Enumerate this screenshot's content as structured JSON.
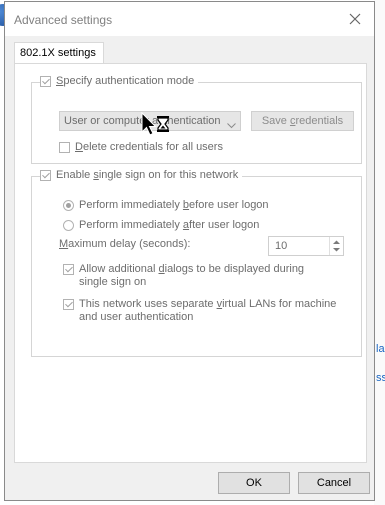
{
  "window": {
    "title": "Advanced settings",
    "close_icon": "close-icon"
  },
  "tabs": [
    {
      "label": "802.1X settings",
      "selected": true
    }
  ],
  "auth_group": {
    "specify_auth_mode": {
      "label_pre": "",
      "label_u": "S",
      "label_post": "pecify authentication mode",
      "checked": true
    },
    "auth_mode_dropdown": {
      "value_pre": "User or compute",
      "value_tail": "r authentication",
      "icon": "chevron-down-icon"
    },
    "save_credentials": {
      "label_pre": "Save ",
      "label_u": "c",
      "label_post": "redentials"
    },
    "delete_credentials": {
      "label_pre": "",
      "label_u": "D",
      "label_post": "elete credentials for all users",
      "checked": false
    }
  },
  "sso_group": {
    "enable_sso": {
      "label_pre": "Enable ",
      "label_u": "s",
      "label_post": "ingle sign on for this network",
      "checked": true
    },
    "before_logon": {
      "label_pre": "Perform immediately ",
      "label_u": "b",
      "label_post": "efore user logon",
      "selected": true
    },
    "after_logon": {
      "label_pre": "Perform immediately ",
      "label_u": "a",
      "label_post": "fter user logon",
      "selected": false
    },
    "max_delay": {
      "label_pre": "",
      "label_u": "M",
      "label_post": "aximum delay (seconds):",
      "value": "10"
    },
    "allow_dialogs": {
      "label_pre": "Allow additional ",
      "label_u": "d",
      "label_post": "ialogs to be displayed during single sign on",
      "checked": true
    },
    "separate_vlans": {
      "label_pre": "This network uses separate ",
      "label_u": "v",
      "label_post": "irtual LANs for machine and user authentication",
      "checked": true
    }
  },
  "buttons": {
    "ok": "OK",
    "cancel": "Cancel"
  },
  "background": {
    "fragment_1": "la",
    "fragment_2": "ss"
  },
  "colors": {
    "dialog_bg": "#f0f0f0",
    "panel_bg": "#ffffff",
    "disabled_text": "#6d6d6d",
    "link_blue": "#1a66c2"
  },
  "cursor": "busy-pointer-icon"
}
